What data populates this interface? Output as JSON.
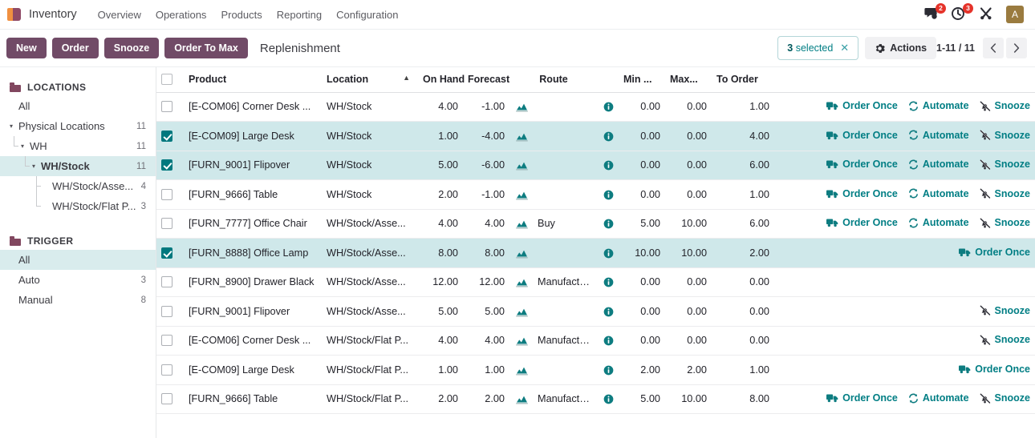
{
  "navbar": {
    "brand": "Inventory",
    "menus": [
      "Overview",
      "Operations",
      "Products",
      "Reporting",
      "Configuration"
    ],
    "messages_badge": "2",
    "activities_badge": "3",
    "avatar_initial": "A",
    "icons": {
      "messages": "chat-bubble-icon",
      "activities": "clock-activity-icon",
      "debug": "tools-icon"
    }
  },
  "controlpanel": {
    "buttons": [
      "New",
      "Order",
      "Snooze",
      "Order To Max"
    ],
    "title": "Replenishment",
    "selection_count": "3",
    "selection_label": "selected",
    "selection_clear": "✕",
    "actions_label": "Actions",
    "pager": "1-11 / 11"
  },
  "sidebar": {
    "sections": [
      {
        "title": "LOCATIONS",
        "items": [
          {
            "label": "All",
            "count": "",
            "level": 1,
            "caret": "",
            "selected": false
          },
          {
            "label": "Physical Locations",
            "count": "11",
            "level": 1,
            "caret": "▾",
            "selected": false
          },
          {
            "label": "WH",
            "count": "11",
            "level": 2,
            "caret": "▾",
            "selected": false
          },
          {
            "label": "WH/Stock",
            "count": "11",
            "level": 3,
            "caret": "▾",
            "selected": true
          },
          {
            "label": "WH/Stock/Asse...",
            "count": "4",
            "level": 4,
            "caret": "",
            "selected": false
          },
          {
            "label": "WH/Stock/Flat P...",
            "count": "3",
            "level": 4,
            "caret": "",
            "selected": false
          }
        ]
      },
      {
        "title": "TRIGGER",
        "items": [
          {
            "label": "All",
            "count": "",
            "level": 1,
            "caret": "",
            "selected": true
          },
          {
            "label": "Auto",
            "count": "3",
            "level": 1,
            "caret": "",
            "selected": false
          },
          {
            "label": "Manual",
            "count": "8",
            "level": 1,
            "caret": "",
            "selected": false
          }
        ]
      }
    ]
  },
  "table": {
    "columns": [
      "Product",
      "Location",
      "On Hand",
      "Forecast",
      "Route",
      "Min ...",
      "Max...",
      "To Order"
    ],
    "sorted_column": "Location",
    "sort_direction": "asc",
    "rows": [
      {
        "selected": false,
        "product": "[E-COM06] Corner Desk ...",
        "location": "WH/Stock",
        "on_hand": "4.00",
        "forecast": "-1.00",
        "route": "",
        "min": "0.00",
        "max": "0.00",
        "to_order": "1.00",
        "actions": [
          "Order Once",
          "Automate",
          "Snooze"
        ]
      },
      {
        "selected": true,
        "product": "[E-COM09] Large Desk",
        "location": "WH/Stock",
        "on_hand": "1.00",
        "forecast": "-4.00",
        "route": "",
        "min": "0.00",
        "max": "0.00",
        "to_order": "4.00",
        "actions": [
          "Order Once",
          "Automate",
          "Snooze"
        ]
      },
      {
        "selected": true,
        "product": "[FURN_9001] Flipover",
        "location": "WH/Stock",
        "on_hand": "5.00",
        "forecast": "-6.00",
        "route": "",
        "min": "0.00",
        "max": "0.00",
        "to_order": "6.00",
        "actions": [
          "Order Once",
          "Automate",
          "Snooze"
        ]
      },
      {
        "selected": false,
        "product": "[FURN_9666] Table",
        "location": "WH/Stock",
        "on_hand": "2.00",
        "forecast": "-1.00",
        "route": "",
        "min": "0.00",
        "max": "0.00",
        "to_order": "1.00",
        "actions": [
          "Order Once",
          "Automate",
          "Snooze"
        ]
      },
      {
        "selected": false,
        "product": "[FURN_7777] Office Chair",
        "location": "WH/Stock/Asse...",
        "on_hand": "4.00",
        "forecast": "4.00",
        "route": "Buy",
        "min": "5.00",
        "max": "10.00",
        "to_order": "6.00",
        "actions": [
          "Order Once",
          "Automate",
          "Snooze"
        ]
      },
      {
        "selected": true,
        "product": "[FURN_8888] Office Lamp",
        "location": "WH/Stock/Asse...",
        "on_hand": "8.00",
        "forecast": "8.00",
        "route": "",
        "min": "10.00",
        "max": "10.00",
        "to_order": "2.00",
        "actions": [
          "Order Once"
        ]
      },
      {
        "selected": false,
        "product": "[FURN_8900] Drawer Black",
        "location": "WH/Stock/Asse...",
        "on_hand": "12.00",
        "forecast": "12.00",
        "route": "Manufacture",
        "min": "0.00",
        "max": "0.00",
        "to_order": "0.00",
        "actions": []
      },
      {
        "selected": false,
        "product": "[FURN_9001] Flipover",
        "location": "WH/Stock/Asse...",
        "on_hand": "5.00",
        "forecast": "5.00",
        "route": "",
        "min": "0.00",
        "max": "0.00",
        "to_order": "0.00",
        "actions": [
          "Snooze"
        ]
      },
      {
        "selected": false,
        "product": "[E-COM06] Corner Desk ...",
        "location": "WH/Stock/Flat P...",
        "on_hand": "4.00",
        "forecast": "4.00",
        "route": "Manufacture",
        "min": "0.00",
        "max": "0.00",
        "to_order": "0.00",
        "actions": [
          "Snooze"
        ]
      },
      {
        "selected": false,
        "product": "[E-COM09] Large Desk",
        "location": "WH/Stock/Flat P...",
        "on_hand": "1.00",
        "forecast": "1.00",
        "route": "",
        "min": "2.00",
        "max": "2.00",
        "to_order": "1.00",
        "actions": [
          "Order Once"
        ]
      },
      {
        "selected": false,
        "product": "[FURN_9666] Table",
        "location": "WH/Stock/Flat P...",
        "on_hand": "2.00",
        "forecast": "2.00",
        "route": "Manufacture",
        "min": "5.00",
        "max": "10.00",
        "to_order": "8.00",
        "actions": [
          "Order Once",
          "Automate",
          "Snooze"
        ]
      }
    ]
  },
  "colors": {
    "primary": "#714b67",
    "accent_teal": "#017e84",
    "selected_row": "#cfe8ea",
    "badge_red": "#e5332a",
    "avatar_bg": "#9a7b3f"
  }
}
